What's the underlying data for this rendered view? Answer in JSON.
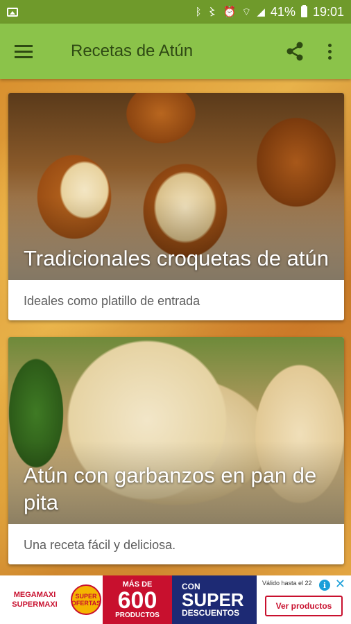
{
  "status_bar": {
    "battery": "41%",
    "time": "19:01",
    "icons": [
      "image-icon",
      "bluetooth-icon",
      "vibrate-icon",
      "alarm-icon",
      "wifi-icon",
      "signal-icon",
      "battery-icon"
    ]
  },
  "app_bar": {
    "title": "Recetas de Atún",
    "icons": [
      "menu-icon",
      "share-icon",
      "more-vert-icon"
    ]
  },
  "recipes": [
    {
      "title": "Tradicionales croquetas de atún",
      "subtitle": "Ideales como platillo de entrada"
    },
    {
      "title": "Atún con garbanzos en pan de pita",
      "subtitle": "Una receta fácil y deliciosa."
    }
  ],
  "ad": {
    "brand_line1": "MEGAMAXI",
    "brand_line2": "SUPERMAXI",
    "badge": "SUPER OFERTAS",
    "more_than": "MÁS DE",
    "count": "600",
    "products": "PRODUCTOS",
    "con": "CON",
    "super": "SUPER",
    "discounts": "DESCUENTOS",
    "valid": "Válido hasta el 22",
    "cta": "Ver productos",
    "info_glyph": "i",
    "close_glyph": "✕"
  },
  "colors": {
    "status_bar": "#6f9a2b",
    "app_bar": "#8bc34a",
    "title_text": "#2f4a14",
    "ad_red": "#c8102e",
    "ad_navy": "#1d2a74"
  }
}
